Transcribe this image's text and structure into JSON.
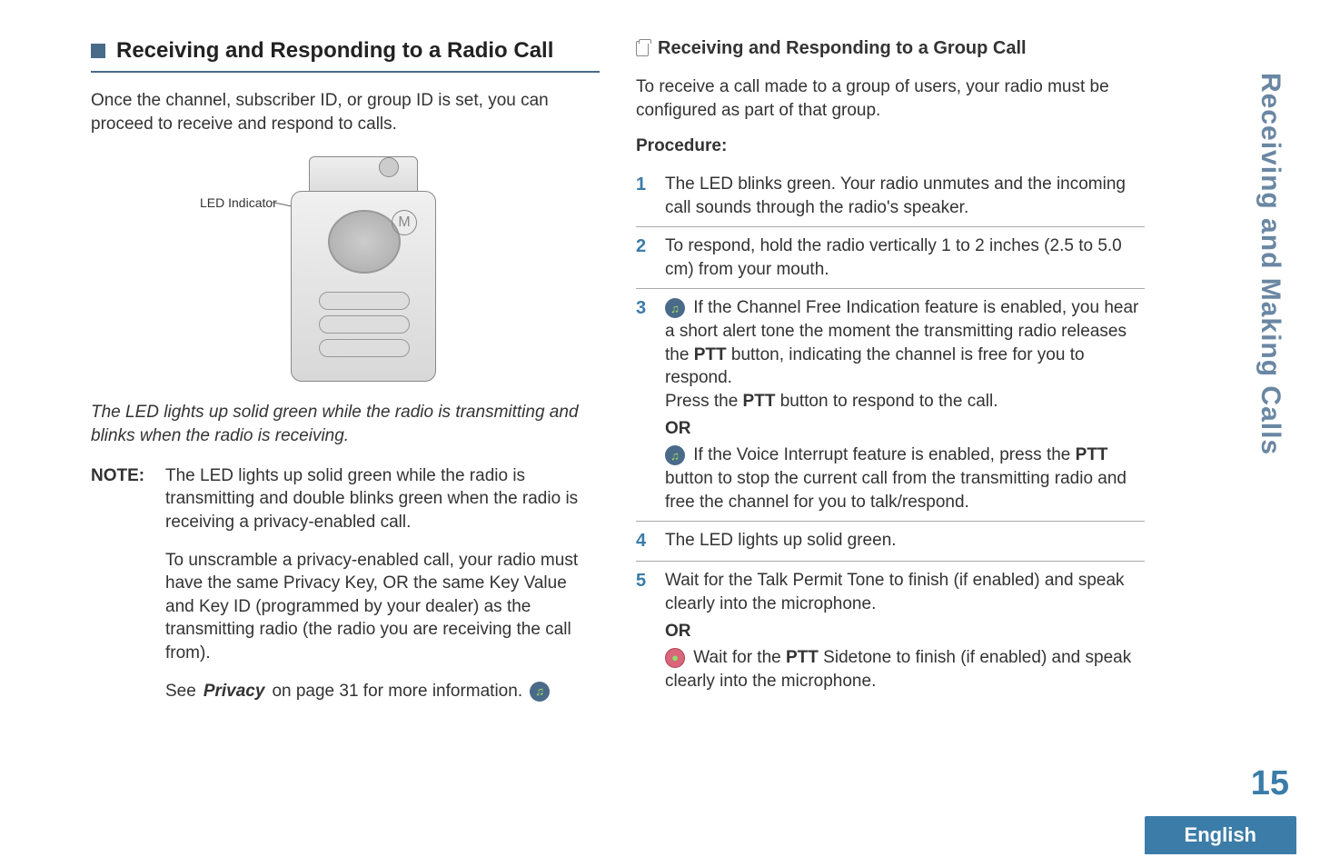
{
  "left": {
    "section_title": "Receiving and Responding to a Radio Call",
    "intro": "Once the channel, subscriber ID, or group ID is set, you can proceed to receive and respond to calls.",
    "led_indicator_label": "LED Indicator",
    "caption": "The LED lights up solid green while the radio is transmitting and blinks when the radio is receiving.",
    "note_label": "NOTE:",
    "note_p1": "The LED lights up solid green while the radio is transmitting and double blinks green when the radio is receiving a privacy-enabled call.",
    "note_p2": "To unscramble a privacy-enabled call, your radio must have the same Privacy Key, OR the same Key Value and Key ID (programmed by your dealer) as the transmitting radio (the radio you are receiving the call from).",
    "see_prefix": "See ",
    "see_link": "Privacy",
    "see_suffix": " on page 31 for more information."
  },
  "right": {
    "sub_title": "Receiving and Responding to a Group Call",
    "intro": "To receive a call made to a group of users, your radio must be configured as part of that group.",
    "procedure_label": "Procedure:",
    "steps": {
      "s1": "The LED blinks green. Your radio unmutes and the incoming call sounds through the radio's speaker.",
      "s2": "To respond, hold the radio vertically 1 to 2 inches (2.5 to 5.0 cm) from your mouth.",
      "s3a_pre": "If the Channel Free Indication feature is enabled, you hear a short alert tone the moment the transmitting radio releases the ",
      "s3a_btn": "PTT",
      "s3a_post": " button, indicating the channel is free for you to respond.",
      "s3b_pre": "Press the ",
      "s3b_btn": "PTT",
      "s3b_post": " button to respond to the call.",
      "or": "OR",
      "s3c_pre": "If the Voice Interrupt feature is enabled, press the ",
      "s3c_btn": "PTT",
      "s3c_post": " button to stop the current call from the transmitting radio and free the channel for you to talk/respond.",
      "s4": "The LED lights up solid green.",
      "s5a": "Wait for the Talk Permit Tone to finish (if enabled) and speak clearly into the microphone.",
      "s5b_pre": "Wait for the ",
      "s5b_btn": "PTT",
      "s5b_post": " Sidetone to finish (if enabled) and speak clearly into the microphone."
    }
  },
  "sideband": "Receiving and Making Calls",
  "page_number": "15",
  "english": "English",
  "icons": {
    "pulse": "♫",
    "ptt_circle": "⬤"
  }
}
